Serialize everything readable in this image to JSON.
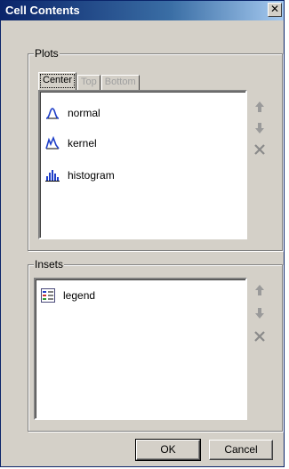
{
  "window": {
    "title": "Cell Contents",
    "close_label": "✕"
  },
  "plots": {
    "group_label": "Plots",
    "tabs": [
      {
        "label": "Center",
        "active": true
      },
      {
        "label": "Top",
        "active": false
      },
      {
        "label": "Bottom",
        "active": false
      }
    ],
    "items": [
      {
        "label": "normal",
        "icon": "normal-curve-icon"
      },
      {
        "label": "kernel",
        "icon": "kernel-curve-icon"
      },
      {
        "label": "histogram",
        "icon": "histogram-icon"
      }
    ]
  },
  "insets": {
    "group_label": "Insets",
    "items": [
      {
        "label": "legend",
        "icon": "legend-icon"
      }
    ]
  },
  "side_buttons": [
    "move-up-icon",
    "move-down-icon",
    "delete-icon"
  ],
  "buttons": {
    "ok": "OK",
    "cancel": "Cancel"
  }
}
